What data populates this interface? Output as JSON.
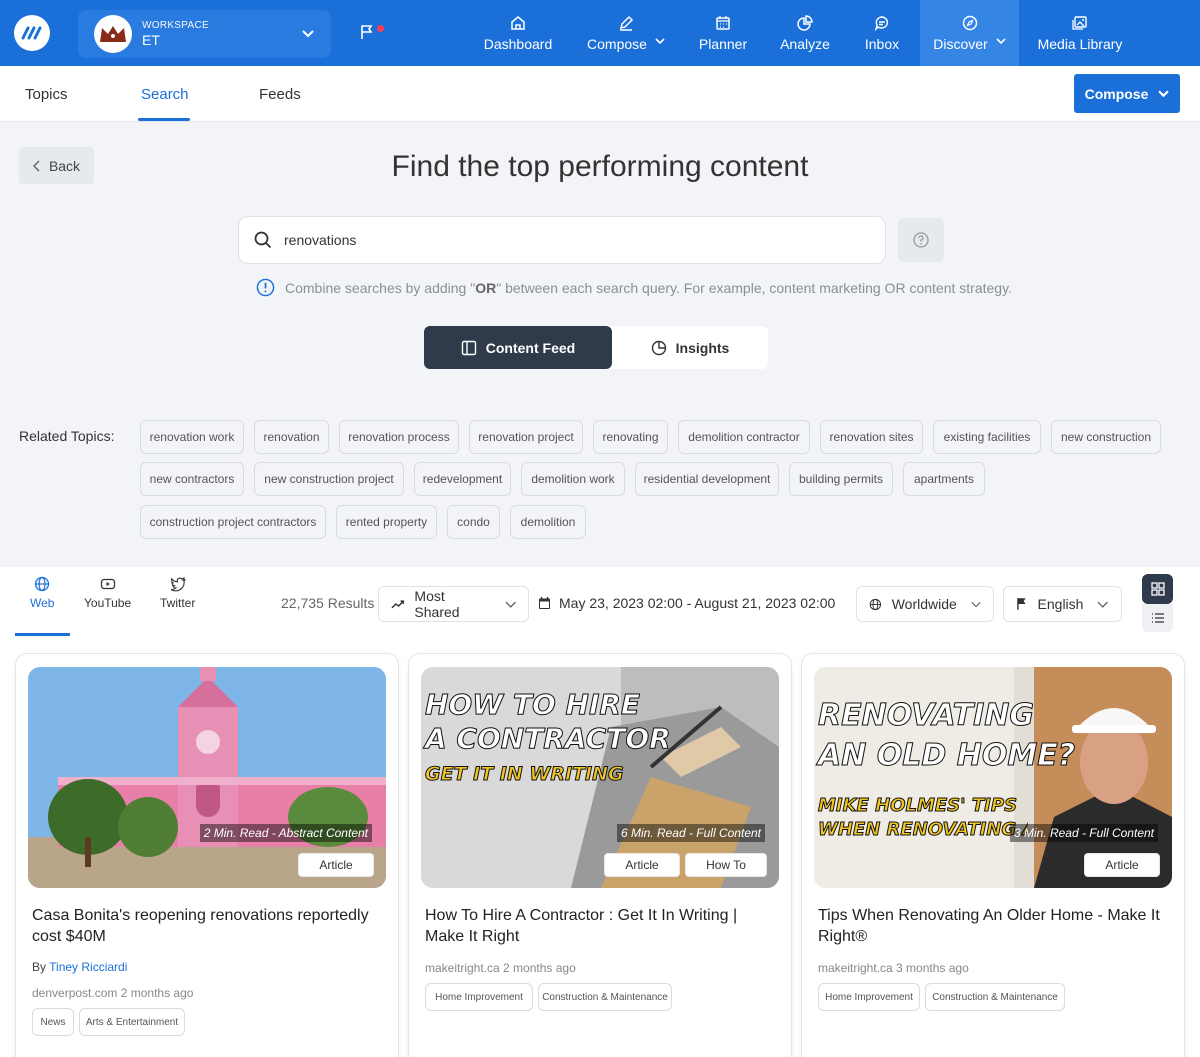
{
  "topbar": {
    "workspace_label": "WORKSPACE",
    "workspace_name": "ET",
    "nav": [
      {
        "label": "Dashboard",
        "icon": "home-icon"
      },
      {
        "label": "Compose",
        "icon": "pen-icon"
      },
      {
        "label": "Planner",
        "icon": "calendar-icon"
      },
      {
        "label": "Analyze",
        "icon": "pie-chart-icon"
      },
      {
        "label": "Inbox",
        "icon": "chat-icon"
      },
      {
        "label": "Discover",
        "icon": "compass-icon"
      },
      {
        "label": "Media Library",
        "icon": "image-icon"
      }
    ]
  },
  "subnav": {
    "tabs": [
      "Topics",
      "Search",
      "Feeds"
    ],
    "active_tab": "Search",
    "compose_label": "Compose"
  },
  "main": {
    "back_label": "Back",
    "heading": "Find the top performing content",
    "search_value": "renovations",
    "tip_prefix": "Combine searches by adding \"",
    "tip_keyword": "OR",
    "tip_suffix": "\" between each search query. For example, content marketing OR content strategy.",
    "view_toggle": [
      "Content Feed",
      "Insights"
    ],
    "related_label": "Related Topics:",
    "related_topics": [
      "renovation work",
      "renovation",
      "renovation process",
      "renovation project",
      "renovating",
      "demolition contractor",
      "renovation sites",
      "existing facilities",
      "new construction",
      "new contractors",
      "new construction project",
      "redevelopment",
      "demolition work",
      "residential development",
      "building permits",
      "apartments",
      "construction project contractors",
      "rented property",
      "condo",
      "demolition"
    ]
  },
  "results": {
    "source_tabs": [
      "Web",
      "YouTube",
      "Twitter"
    ],
    "count": "22,735 Results",
    "sort": "Most Shared",
    "date_range": "May 23, 2023 02:00 - August 21, 2023 02:00",
    "region": "Worldwide",
    "language": "English"
  },
  "cards": [
    {
      "read_time": "2 Min. Read - Abstract Content",
      "badges": [
        "Article"
      ],
      "title": "Casa Bonita's reopening renovations reportedly cost $40M",
      "by_label": "By",
      "author": "Tiney Ricciardi",
      "source": "denverpost.com 2 months ago",
      "tags": [
        "News",
        "Arts & Entertainment"
      ]
    },
    {
      "read_time": "6 Min. Read - Full Content",
      "badges": [
        "Article",
        "How To"
      ],
      "thumb_text": [
        "HOW TO HIRE",
        "A CONTRACTOR",
        "GET IT IN WRITING"
      ],
      "title": "How To Hire A Contractor : Get It In Writing | Make It Right",
      "source": "makeitright.ca 2 months ago",
      "tags": [
        "Home Improvement",
        "Construction & Maintenance"
      ]
    },
    {
      "read_time": "3 Min. Read - Full Content",
      "badges": [
        "Article"
      ],
      "thumb_text": [
        "RENOVATING",
        "AN OLD HOME?",
        "MIKE HOLMES' TIPS",
        "WHEN RENOVATING AN OLDER HOME"
      ],
      "title": "Tips When Renovating An Older Home - Make It Right®",
      "source": "makeitright.ca 3 months ago",
      "tags": [
        "Home Improvement",
        "Construction & Maintenance"
      ]
    }
  ],
  "colors": {
    "brand": "#1b6fd8",
    "dark": "#2f3a4a",
    "page_bg": "#f2f4f7"
  }
}
